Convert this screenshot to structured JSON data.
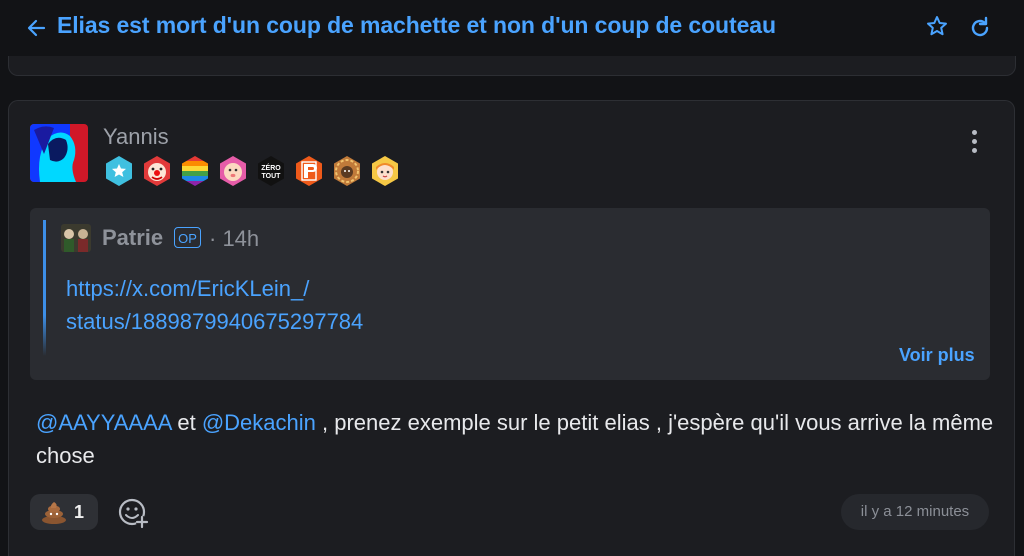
{
  "header": {
    "title": "Elias est mort d'un coup de machette et non d'un coup de couteau",
    "back_icon": "arrow-left-icon",
    "favorite_icon": "star-icon",
    "refresh_icon": "refresh-icon"
  },
  "post": {
    "author": "Yannis",
    "badges": [
      "star-badge",
      "clown-badge",
      "rainbow-badge",
      "baby-badge",
      "zero-tout-badge",
      "p-logo-badge",
      "hedgehog-badge",
      "girl-badge"
    ],
    "badge_text_zero": "ZÉRO TOUT",
    "quote": {
      "author": "Patrie",
      "op_label": "OP",
      "time": "· 14h",
      "link_line1": "https://x.com/EricKLein_/",
      "link_line2": "status/1889879940675297784",
      "more_label": "Voir plus"
    },
    "mention1": "@AAYYAAAA",
    "word_et": " et ",
    "mention2": "@Dekachin",
    "text": " , prenez exemple sur le petit elias , j'espère qu'il vous arrive la même chose",
    "reaction": {
      "emoji": "poop-emoji",
      "count": "1"
    },
    "timestamp": "il y a 12 minutes"
  },
  "colors": {
    "accent": "#4aa3ff",
    "background": "#121316",
    "card": "#1c1d21",
    "quote_bg": "#2a2c31"
  }
}
